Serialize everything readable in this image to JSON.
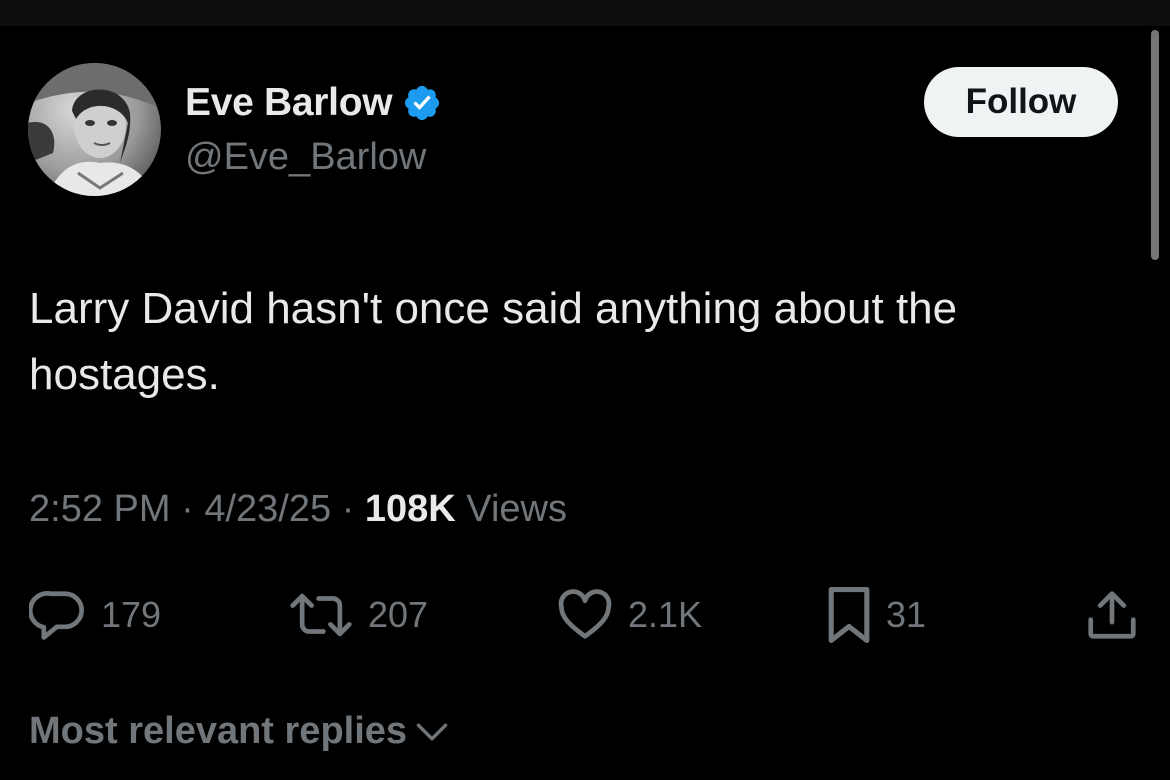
{
  "author": {
    "display_name": "Eve Barlow",
    "handle": "@Eve_Barlow",
    "verified": true,
    "avatar_icon": "profile-photo"
  },
  "follow_button": {
    "label": "Follow"
  },
  "tweet": {
    "text": "Larry David hasn't once said anything about the hostages.",
    "time": "2:52 PM",
    "date": "4/23/25",
    "separator": " · ",
    "views_count": "108K",
    "views_label": " Views"
  },
  "actions": {
    "reply": {
      "icon": "reply-icon",
      "count": "179"
    },
    "repost": {
      "icon": "repost-icon",
      "count": "207"
    },
    "like": {
      "icon": "heart-icon",
      "count": "2.1K"
    },
    "bookmark": {
      "icon": "bookmark-icon",
      "count": "31"
    },
    "share": {
      "icon": "share-icon"
    }
  },
  "replies_sort": {
    "label": "Most relevant replies"
  },
  "colors": {
    "background": "#000000",
    "primary_text": "#e7e9ea",
    "secondary_text": "#71767b",
    "verified_blue": "#1d9bf0",
    "follow_bg": "#eff3f4"
  }
}
